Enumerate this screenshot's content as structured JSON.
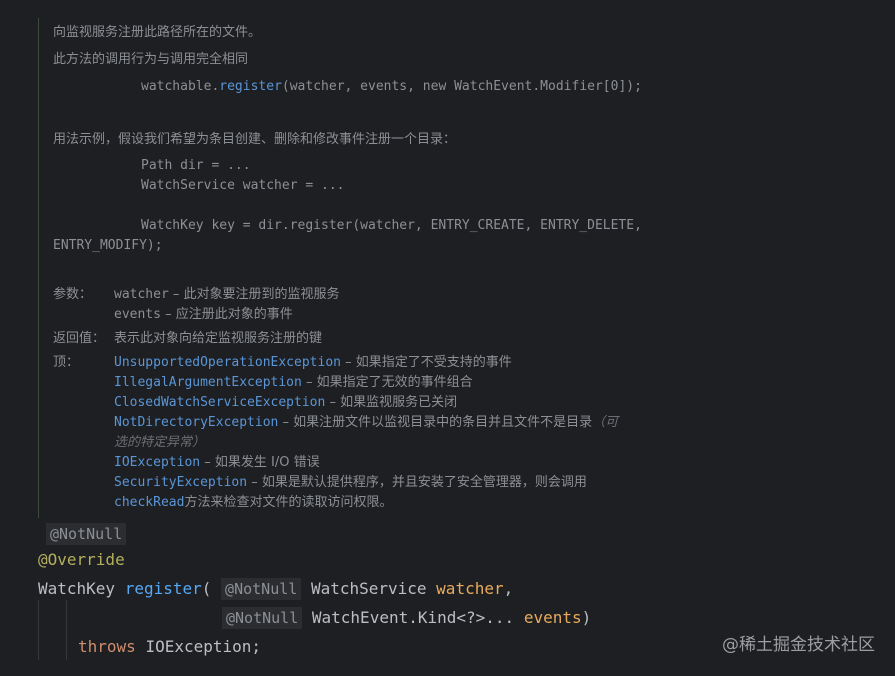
{
  "doc": {
    "line1": "向监视服务注册此路径所在的文件。",
    "line2": "此方法的调用行为与调用完全相同",
    "code1_prefix": "watchable.",
    "code1_method": "register",
    "code1_suffix": "(watcher, events, new WatchEvent.Modifier[0]);",
    "usage_label": "用法示例，假设我们希望为条目创建、删除和修改事件注册一个目录：",
    "ex1": "Path dir = ...",
    "ex2": "WatchService watcher = ...",
    "ex3": "WatchKey key = dir.register(watcher, ENTRY_CREATE, ENTRY_DELETE,",
    "ex4": "ENTRY_MODIFY);",
    "params_label": "参数：",
    "param1_name": "watcher",
    "param1_desc": " – 此对象要注册到的监视服务",
    "param2_name": "events",
    "param2_desc": " – 应注册此对象的事件",
    "returns_label": "返回值：",
    "returns_desc": "表示此对象向给定监视服务注册的键",
    "throws_label": "顶：",
    "throws": [
      {
        "name": "UnsupportedOperationException",
        "desc": " – 如果指定了不受支持的事件"
      },
      {
        "name": "IllegalArgumentException",
        "desc": " – 如果指定了无效的事件组合"
      },
      {
        "name": "ClosedWatchServiceException",
        "desc": " – 如果监视服务已关闭"
      },
      {
        "name": "NotDirectoryException",
        "desc": " – 如果注册文件以监视目录中的条目并且文件不是目录",
        "extra": "（可"
      },
      {
        "name": "IOException",
        "desc": " – 如果发生 I/O 错误"
      },
      {
        "name": "SecurityException",
        "desc": " – 如果是默认提供程序，并且安装了安全管理器，则会调用"
      }
    ],
    "throws4_cont": "选的特定异常）",
    "throws6_cont_link": "checkRead",
    "throws6_cont_text": "方法来检查对文件的读取访问权限。"
  },
  "code": {
    "annot_notnull": "@NotNull",
    "override": "@Override",
    "return_type": "WatchKey",
    "method": "register",
    "open_paren": "(",
    "param1_annot": "@NotNull",
    "param1_type": "WatchService",
    "param1_name": "watcher",
    "comma": ",",
    "param2_annot": "@NotNull",
    "param2_type": "WatchEvent.Kind",
    "param2_generic": "<?>...",
    "param2_name": "events",
    "close_paren": ")",
    "throws_kw": "throws",
    "exception": "IOException",
    "semicolon": ";"
  },
  "watermark": "@稀土掘金技术社区"
}
